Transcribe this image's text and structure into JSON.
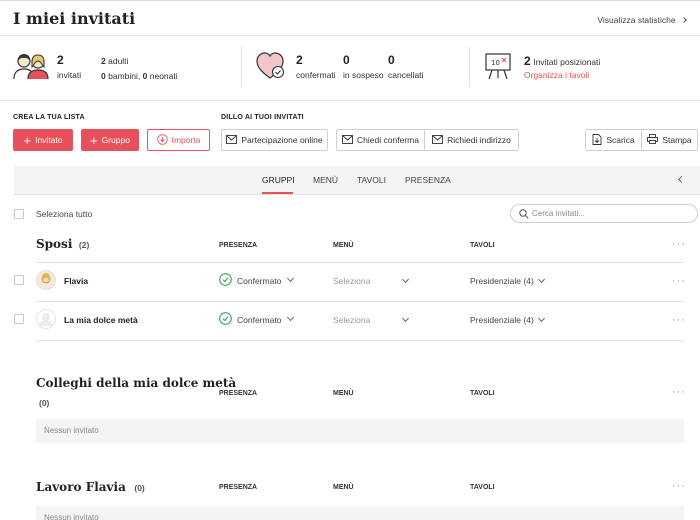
{
  "header": {
    "title": "I miei invitati",
    "stats_link": "Visualizza statistiche"
  },
  "summary": {
    "guests": {
      "count": "2",
      "label": "invitati"
    },
    "adults": {
      "count": "2",
      "label": "adulti"
    },
    "children": {
      "count": "0",
      "label": "bambini,"
    },
    "infants": {
      "count": "0",
      "label": "neonati"
    },
    "confirmed": {
      "count": "2",
      "label": "confermati"
    },
    "pending": {
      "count": "0",
      "label": "in sospeso"
    },
    "cancelled": {
      "count": "0",
      "label": "cancellati"
    },
    "seated": {
      "count": "2",
      "label": "Invitati posizionati",
      "link": "Organizza i tavoli"
    }
  },
  "toolbar": {
    "create_label": "CREA LA TUA LISTA",
    "invite_label": "DILLO AI TUOI INVITATI",
    "add_guest": "Invitato",
    "add_group": "Gruppo",
    "import": "Importa",
    "online_rsvp": "Partecipazione online",
    "ask_confirm": "Chiedi conferma",
    "ask_address": "Richiedi indirizzo",
    "download": "Scarica",
    "print": "Stampa"
  },
  "tabs": [
    {
      "label": "GRUPPI",
      "active": true
    },
    {
      "label": "MENÙ",
      "active": false
    },
    {
      "label": "TAVOLI",
      "active": false
    },
    {
      "label": "PRESENZA",
      "active": false
    }
  ],
  "list": {
    "select_all": "Seleziona tutto",
    "search_placeholder": "Cerca invitati...",
    "col_presence": "PRESENZA",
    "col_menu": "MENÙ",
    "col_tables": "TAVOLI",
    "empty": "Nessun invitato"
  },
  "groups": [
    {
      "name": "Sposi",
      "count": "(2)",
      "guests": [
        {
          "name": "Flavia",
          "presence": "Confermato",
          "menu": "Seleziona",
          "table": "Presidenziale (4)"
        },
        {
          "name": "La mia dolce metà",
          "presence": "Confermato",
          "menu": "Seleziona",
          "table": "Presidenziale (4)"
        }
      ]
    },
    {
      "name": "Colleghi della mia dolce metà",
      "count": "(0)",
      "guests": []
    },
    {
      "name": "Lavoro Flavia",
      "count": "(0)",
      "guests": []
    }
  ],
  "colors": {
    "accent": "#e8505b",
    "success": "#3aa55c"
  }
}
